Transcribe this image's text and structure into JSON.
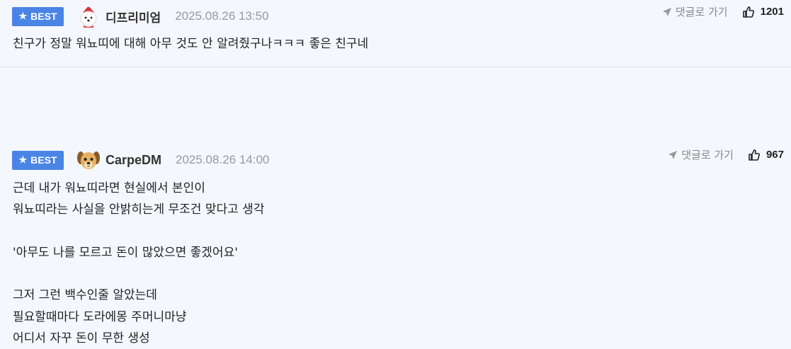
{
  "comments": [
    {
      "badge": "BEST",
      "nickname": "디프리미엄",
      "date": "2025.08.26 13:50",
      "reply_label": "댓글로 가기",
      "likes": "1201",
      "avatar_icon": "white-dog-santa-avatar",
      "text": "친구가 정말 워뇨띠에 대해 아무 것도 안 알려줬구나ㅋㅋㅋ 좋은 친구네"
    },
    {
      "badge": "BEST",
      "nickname": "CarpeDM",
      "date": "2025.08.26 14:00",
      "reply_label": "댓글로 가기",
      "likes": "967",
      "avatar_icon": "puppy-avatar",
      "text": "근데 내가 워뇨띠라면 현실에서 본인이\n워뇨띠라는 사실을 안밝히는게 무조건 맞다고 생각\n\n'아무도 나를 모르고 돈이 많았으면 좋겠어요'\n\n그저 그런 백수인줄 알았는데\n필요할때마다 도라에몽 주머니마냥\n어디서 자꾸 돈이 무한 생성"
    }
  ],
  "colors": {
    "background": "#f4f7fd",
    "badge": "#4a85e6",
    "date": "#999999"
  }
}
